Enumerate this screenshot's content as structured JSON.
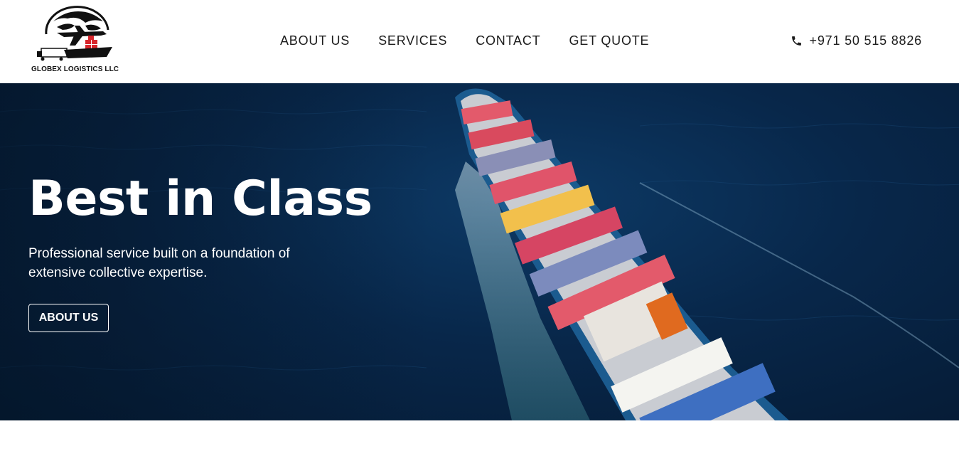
{
  "header": {
    "logo": {
      "icon": "globe-plane-ship-truck-logo",
      "text": "GLOBEX LOGISTICS LLC"
    },
    "nav": [
      {
        "label": "ABOUT US"
      },
      {
        "label": "SERVICES"
      },
      {
        "label": "CONTACT"
      },
      {
        "label": "GET QUOTE"
      }
    ],
    "phone": {
      "icon": "phone-icon",
      "number": "+971 50 515 8826"
    }
  },
  "hero": {
    "title": "Best in Class",
    "subtitle": "Professional service built on a foundation of extensive collective expertise.",
    "button_label": "ABOUT US",
    "background": "aerial-container-ship-ocean"
  },
  "colors": {
    "nav_text": "#1b1b1b",
    "hero_bg": "#08274a",
    "hero_text": "#ffffff"
  }
}
